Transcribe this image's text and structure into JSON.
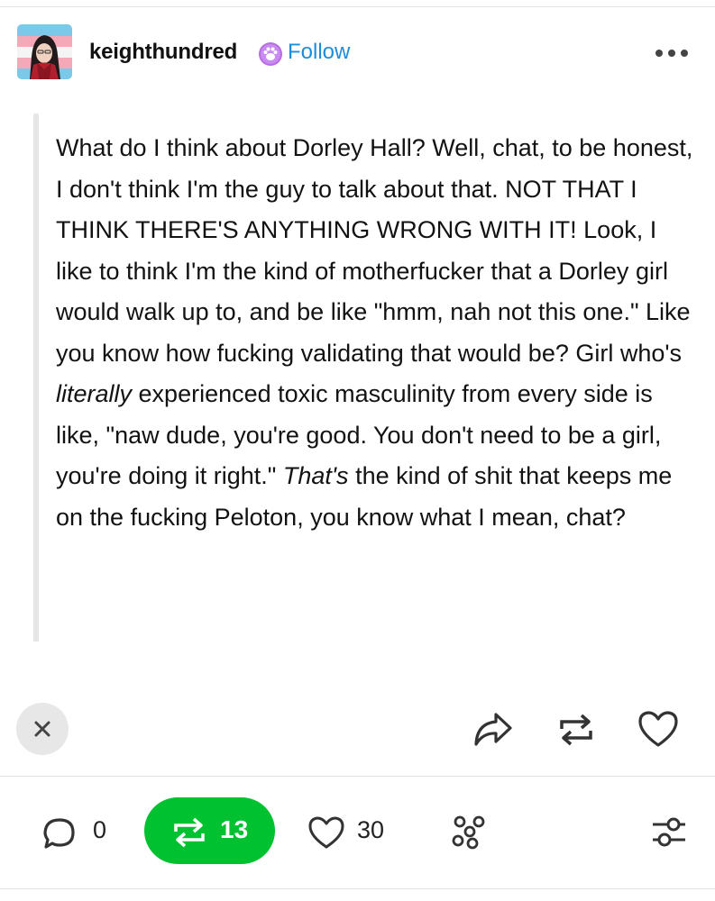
{
  "post": {
    "author": "keighthundred",
    "follow_label": "Follow",
    "body": [
      {
        "text": "What do I think about Dorley Hall? Well, chat, to be honest, I don't think I'm the guy to talk about that. NOT THAT I THINK THERE'S ANYTHING WRONG WITH IT! Look, I like to think I'm the kind of motherfucker that a Dorley girl would walk up to, and be like \"hmm, nah not this one.\" Like you know how fucking validating that would be? Girl who's ",
        "italic": false
      },
      {
        "text": "literally",
        "italic": true
      },
      {
        "text": " experienced toxic masculinity from every side is like, \"naw dude, you're good. You don't need to be a girl, you're doing it right.\" ",
        "italic": false
      },
      {
        "text": "That's",
        "italic": true
      },
      {
        "text": " the kind of shit that keeps me on the fucking Peloton, you know what I mean, chat?",
        "italic": false
      }
    ]
  },
  "actions": {
    "dismiss_icon": "close-icon",
    "share_icon": "share-icon",
    "reblog_icon": "reblog-icon",
    "like_icon": "heart-icon"
  },
  "notes": {
    "replies_count": "0",
    "reblogs_count": "13",
    "likes_count": "30",
    "community_icon": "community-icon",
    "filter_icon": "sliders-icon"
  },
  "colors": {
    "follow": "#1c8ddc",
    "reblog_pill": "#00c12f",
    "badge": "#b76ee0",
    "dismiss_bg": "#e7e7e7"
  }
}
